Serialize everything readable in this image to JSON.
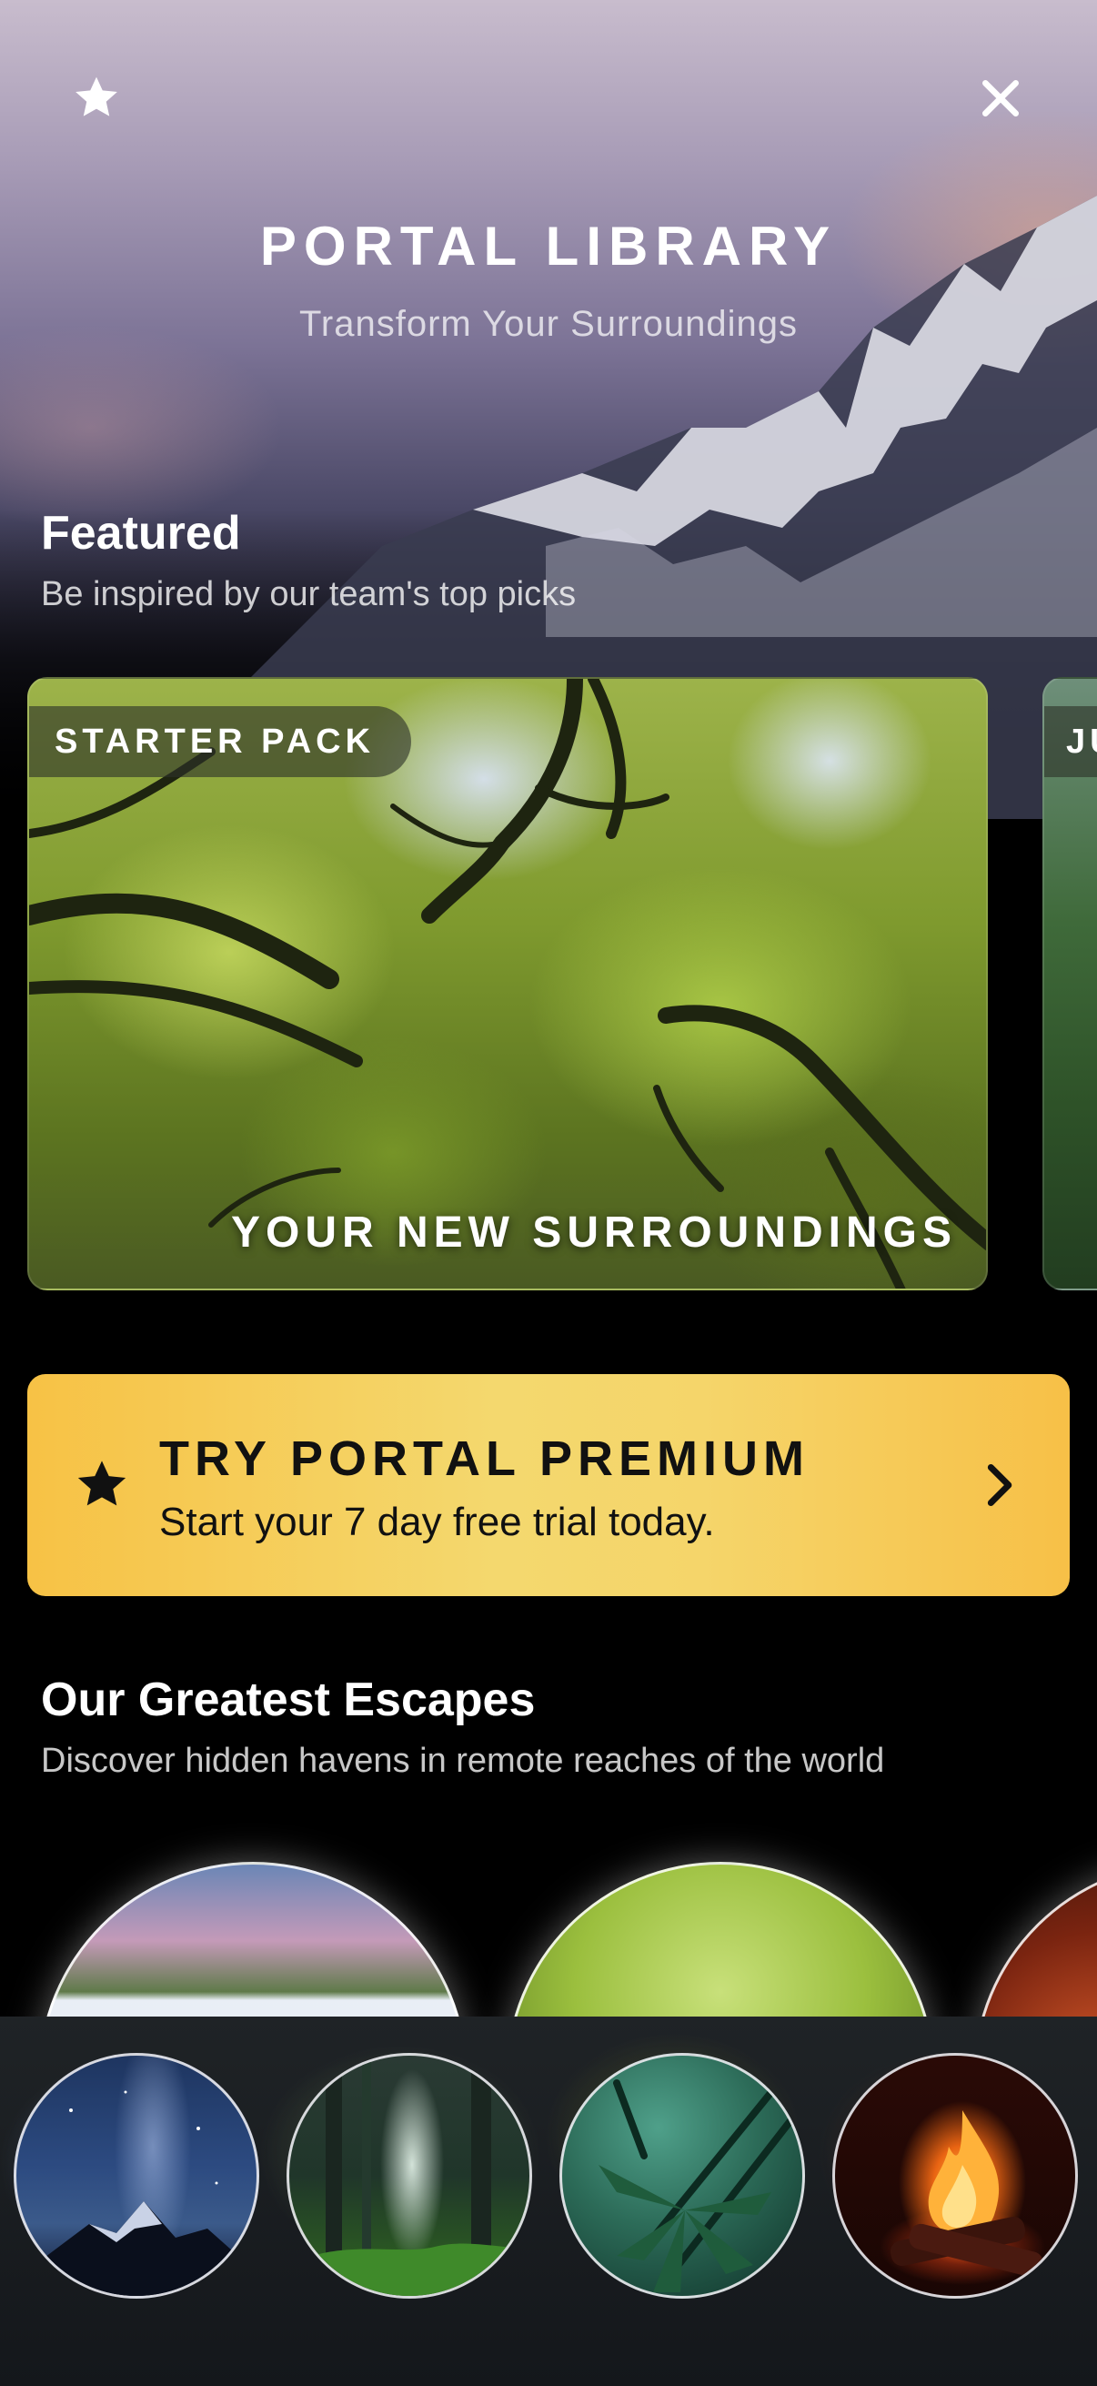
{
  "header": {
    "title": "PORTAL LIBRARY",
    "subtitle": "Transform Your Surroundings",
    "favorite_icon": "star-icon",
    "close_icon": "close-icon"
  },
  "featured": {
    "title": "Featured",
    "subtitle": "Be inspired by our team's top picks",
    "cards": [
      {
        "badge": "STARTER PACK",
        "caption": "YOUR NEW SURROUNDINGS"
      },
      {
        "badge": "JU",
        "caption": ""
      }
    ]
  },
  "premium": {
    "title": "TRY PORTAL PREMIUM",
    "subtitle": "Start your 7 day free trial today.",
    "icon": "star-icon",
    "chevron_icon": "chevron-right-icon",
    "accent_color": "#f6c94e"
  },
  "escapes": {
    "title": "Our Greatest Escapes",
    "subtitle": "Discover hidden havens in remote reaches of the world",
    "items": [
      "waterfall-portal",
      "forest-portal",
      "fire-portal"
    ]
  },
  "tray": {
    "items": [
      "night-sky-mountain",
      "forest-light",
      "tropical-palm",
      "campfire"
    ]
  }
}
